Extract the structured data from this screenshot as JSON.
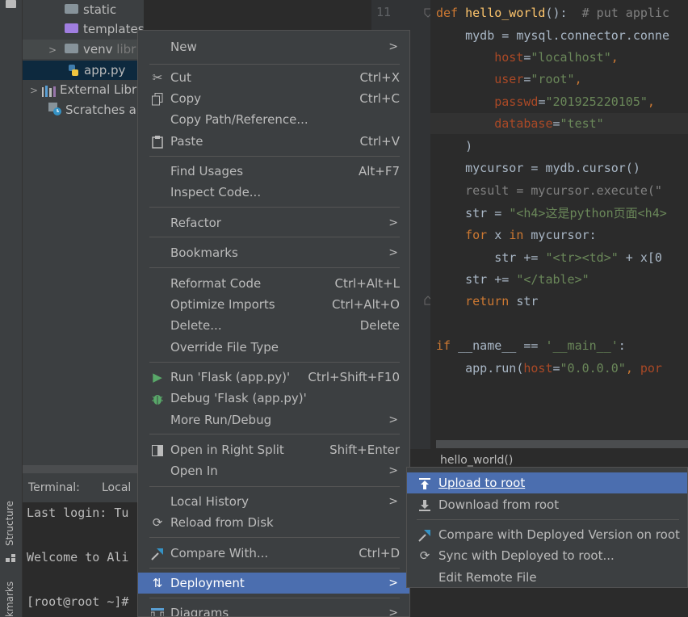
{
  "toolstrip": {
    "structure_label": "Structure",
    "bookmarks_label": "kmarks"
  },
  "project": {
    "items": [
      {
        "label": "static",
        "lib": ""
      },
      {
        "label": "templates",
        "lib": ""
      },
      {
        "label": "venv",
        "lib": "libr"
      },
      {
        "label": "app.py",
        "lib": ""
      },
      {
        "label": "External Libr",
        "lib": ""
      },
      {
        "label": "Scratches an",
        "lib": ""
      }
    ]
  },
  "terminal": {
    "title": "Terminal:",
    "tab": "Local",
    "lines": [
      "Last login: Tu",
      "",
      "Welcome to Ali",
      "",
      "[root@root ~]#"
    ]
  },
  "editor": {
    "line_number": "11",
    "breadcrumb": "hello_world()",
    "code": {
      "l1_def": "def ",
      "l1_fn": "hello_world",
      "l1_rest": "():  ",
      "l1_comment": "# put applic",
      "l2": "    mydb = mysql.connector.conne",
      "l3_key": "        host",
      "l3_val": "\"localhost\"",
      "l4_key": "        user",
      "l4_val": "\"root\"",
      "l5_key": "        passwd",
      "l5_val": "\"201925220105\"",
      "l6_key": "        database",
      "l6_val": "\"test\"",
      "l7": "    )",
      "l8": "    mycursor = mydb.cursor()",
      "l9": "    result = mycursor.execute(\"",
      "l10_a": "    str = ",
      "l10_b": "\"<h4>这是python页面<h4>",
      "l11_kw1": "    for ",
      "l11_mid": "x ",
      "l11_kw2": "in ",
      "l11_end": "mycursor:",
      "l12_a": "        str += ",
      "l12_b": "\"<tr><td>\"",
      "l12_c": " + x[0",
      "l13_a": "    str += ",
      "l13_b": "\"</table>\"",
      "l14_kw": "    return ",
      "l14_end": "str",
      "l15_kw": "if ",
      "l15_a": "__name__ == ",
      "l15_b": "'__main__'",
      "l15_c": ":",
      "l16_a": "    app.run(",
      "l16_k1": "host",
      "l16_v1": "\"0.0.0.0\"",
      "l16_b": ", ",
      "l16_k2": "por"
    }
  },
  "context_menu": {
    "items": {
      "new": {
        "label": "New"
      },
      "cut": {
        "label": "Cut",
        "shortcut": "Ctrl+X"
      },
      "copy": {
        "label": "Copy",
        "shortcut": "Ctrl+C"
      },
      "copy_path": {
        "label": "Copy Path/Reference..."
      },
      "paste": {
        "label": "Paste",
        "shortcut": "Ctrl+V"
      },
      "find_usages": {
        "label": "Find Usages",
        "shortcut": "Alt+F7"
      },
      "inspect_code": {
        "label": "Inspect Code..."
      },
      "refactor": {
        "label": "Refactor"
      },
      "bookmarks": {
        "label": "Bookmarks"
      },
      "reformat": {
        "label": "Reformat Code",
        "shortcut": "Ctrl+Alt+L"
      },
      "optimize": {
        "label": "Optimize Imports",
        "shortcut": "Ctrl+Alt+O"
      },
      "delete": {
        "label": "Delete...",
        "shortcut": "Delete"
      },
      "override": {
        "label": "Override File Type"
      },
      "run": {
        "label": "Run 'Flask (app.py)'",
        "shortcut": "Ctrl+Shift+F10"
      },
      "debug": {
        "label": "Debug 'Flask (app.py)'"
      },
      "more_run": {
        "label": "More Run/Debug"
      },
      "open_split": {
        "label": "Open in Right Split",
        "shortcut": "Shift+Enter"
      },
      "open_in": {
        "label": "Open In"
      },
      "local_history": {
        "label": "Local History"
      },
      "reload": {
        "label": "Reload from Disk"
      },
      "compare": {
        "label": "Compare With...",
        "shortcut": "Ctrl+D"
      },
      "deployment": {
        "label": "Deployment"
      },
      "diagrams": {
        "label": "Diagrams"
      }
    }
  },
  "deployment_submenu": {
    "upload": "Upload to root",
    "download": "Download from root",
    "compare": "Compare with Deployed Version on root",
    "sync": "Sync with Deployed to root...",
    "edit_remote": "Edit Remote File"
  },
  "colors": {
    "accent": "#4b6eaf",
    "menu_bg": "#3c3f41",
    "editor_bg": "#2b2b2b"
  }
}
